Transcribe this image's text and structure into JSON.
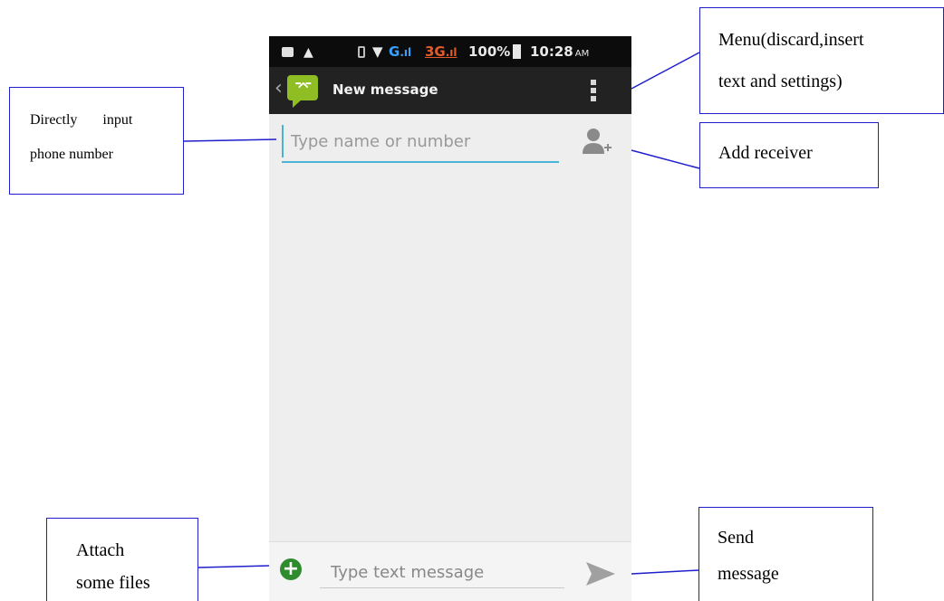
{
  "status_bar": {
    "alert_glyph": "▲",
    "net1": "G",
    "net2": "3G",
    "bars": ".ıl",
    "battery_pct": "100%",
    "time": "10:28",
    "ampm": "AM"
  },
  "action_bar": {
    "back_glyph": "‹",
    "title": "New message"
  },
  "recipient": {
    "placeholder": "Type name or number"
  },
  "compose": {
    "placeholder": "Type text message"
  },
  "annotations": {
    "directly_input": [
      "Directly input",
      "phone number"
    ],
    "menu": [
      "Menu(discard,insert",
      "text and settings)"
    ],
    "add_receiver": "Add receiver",
    "attach": [
      "Attach",
      "some files"
    ],
    "send": [
      "Send",
      "message"
    ]
  },
  "colors": {
    "app_icon": "#8ebd24",
    "field_underline": "#4ab4d8",
    "attach_green": "#2e8b2e",
    "callout_border": "#1f1fcc"
  },
  "icons": {
    "menu": "overflow-menu-icon",
    "add_contact": "add-contact-icon",
    "attach": "plus-circle-icon",
    "send": "send-arrow-icon"
  }
}
